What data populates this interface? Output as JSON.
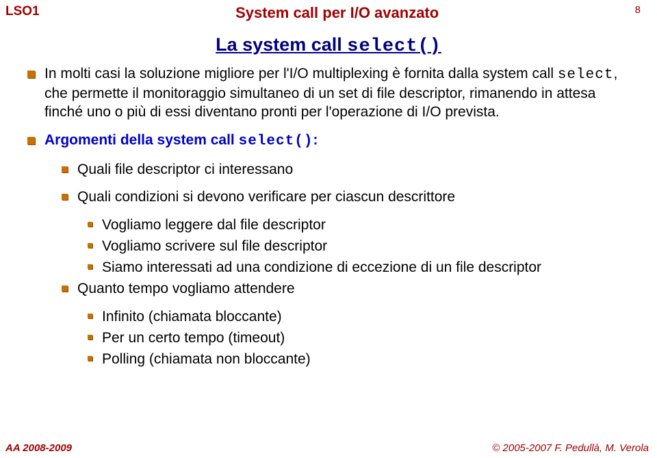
{
  "header": {
    "left": "LSO1",
    "center": "System call per I/O avanzato",
    "page": "8"
  },
  "title": {
    "prefix": "La system call ",
    "code": "select()"
  },
  "bullets": [
    {
      "kind": "text",
      "parts": [
        {
          "t": "In molti casi la soluzione migliore per l'I/O multiplexing è fornita dalla system call "
        },
        {
          "t": "select",
          "code": true
        },
        {
          "t": ", che permette il monitoraggio simultaneo di un set di file descriptor, rimanendo in attesa finché uno o più di essi diventano pronti per l'operazione di I/O prevista."
        }
      ]
    },
    {
      "kind": "arghead",
      "parts": [
        {
          "t": "Argomenti della system call "
        },
        {
          "t": "select()",
          "code": true
        },
        {
          "t": ":"
        }
      ],
      "sub": [
        {
          "text": "Quali file descriptor ci interessano"
        },
        {
          "text": "Quali condizioni si devono verificare per ciascun descrittore",
          "sub2": [
            "Vogliamo leggere dal file descriptor",
            "Vogliamo scrivere sul file descriptor",
            "Siamo interessati ad una condizione di eccezione di un file descriptor"
          ]
        },
        {
          "text": "Quanto tempo vogliamo attendere",
          "sub2": [
            "Infinito (chiamata bloccante)",
            "Per un certo tempo (timeout)",
            "Polling (chiamata non bloccante)"
          ]
        }
      ]
    }
  ],
  "footer": {
    "left": "AA 2008-2009",
    "right": "© 2005-2007 F. Pedullà, M. Verola"
  }
}
